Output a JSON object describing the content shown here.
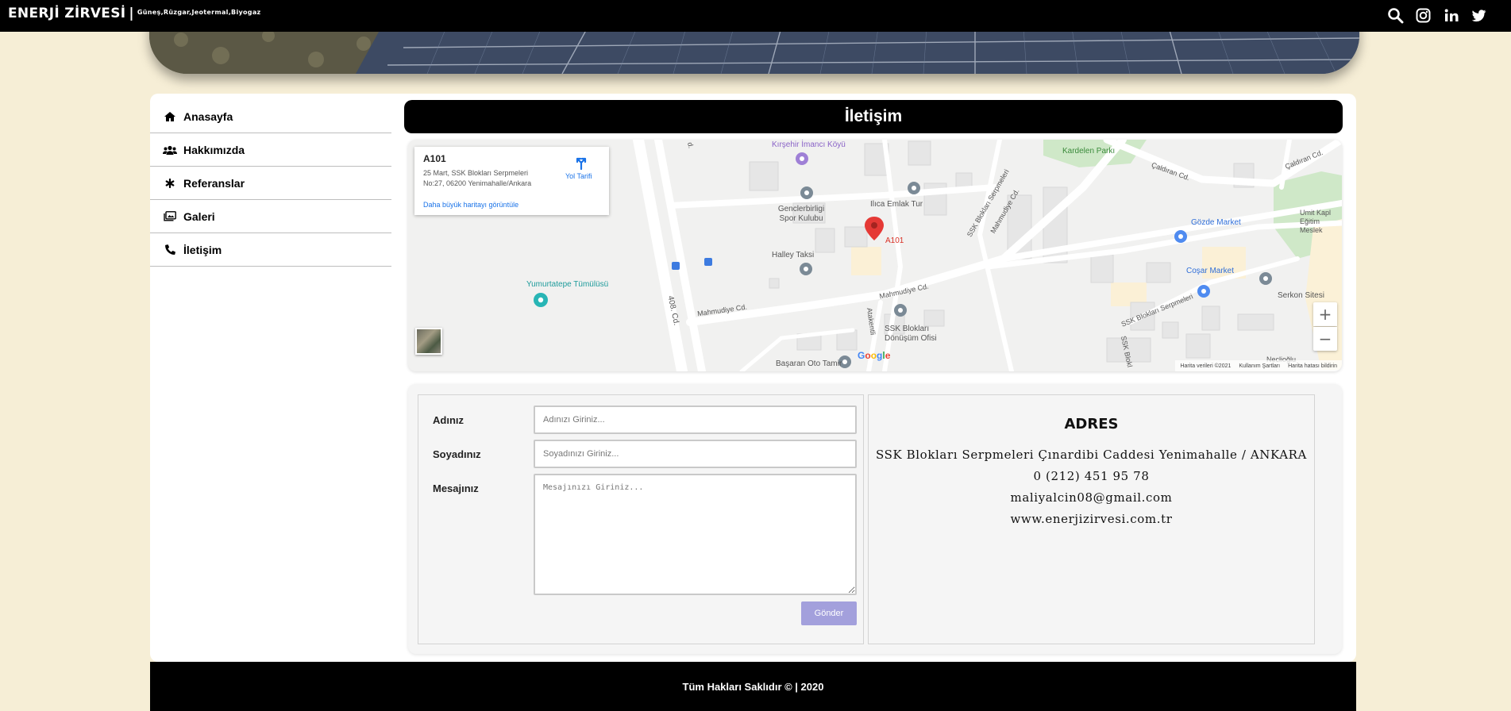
{
  "header": {
    "brand": "ENERJİ ZİRVESİ",
    "separator": "|",
    "tagline": "Güneş,Rüzgar,Jeotermal,Biyogaz",
    "icons": [
      "search-icon",
      "instagram-icon",
      "linkedin-icon",
      "twitter-icon"
    ]
  },
  "sidebar": {
    "items": [
      {
        "label": "Anasayfa",
        "icon": "home-icon"
      },
      {
        "label": "Hakkımızda",
        "icon": "users-icon"
      },
      {
        "label": "Referanslar",
        "icon": "asterisk-icon"
      },
      {
        "label": "Galeri",
        "icon": "images-icon"
      },
      {
        "label": "İletişim",
        "icon": "phone-icon"
      }
    ]
  },
  "page": {
    "title": "İletişim"
  },
  "map": {
    "place_name": "A101",
    "place_address": "25 Mart, SSK Blokları Serpmeleri No:27, 06200 Yenimahalle/Ankara",
    "directions_label": "Yol Tarifi",
    "bigger_map_link": "Daha büyük haritayı görüntüle",
    "zoom_in": "+",
    "zoom_out": "−",
    "google_logo": "Google",
    "footer": {
      "map_data": "Harita verileri ©2021",
      "terms": "Kullanım Şartları",
      "report": "Harita hatası bildirin"
    },
    "labels": {
      "kirsehir": "Kırşehir İmancı Köyü",
      "kardelen": "Kardelen Parkı",
      "genclerbirligi": "Genclerbirligi Spor Kulubu",
      "ilica": "Ilıca Emlak Tur",
      "a101": "A101",
      "halley": "Halley Taksi",
      "yumurtatepe": "Yumurtatepe Tümülüsü",
      "gozde": "Gözde Market",
      "cosar": "Coşar Market",
      "serkon": "Serkon Sitesi",
      "umit": "Umit Kapl Eğitim Meslek",
      "ssk_donusum": "SSK Blokları Dönüşüm Ofisi",
      "basaran": "Başaran Oto Tamir",
      "mahmudiye1": "Mahmudiye Cd.",
      "mahmudiye2": "Mahmudiye Cd.",
      "mahmudiye3": "Mahmudiye Cd.",
      "cd408": "408. Cd.",
      "caldiran1": "Çaldıran Cd.",
      "caldiran2": "Çaldıran Cd.",
      "ssk_serpmeleri1": "SSK Blokları Serpmeleri",
      "ssk_serpmeleri2": "SSK Blokları Serpmeleri",
      "atakentli": "Atakentli",
      "ssk_blok": "SSK Blokl",
      "neclioglu": "Neclioğlu",
      "cd_edge": "d."
    }
  },
  "form": {
    "name_label": "Adınız",
    "name_placeholder": "Adınızı Giriniz...",
    "surname_label": "Soyadınız",
    "surname_placeholder": "Soyadınızı Giriniz...",
    "message_label": "Mesajınız",
    "message_placeholder": "Mesajınızı Giriniz...",
    "submit_label": "Gönder"
  },
  "address": {
    "title": "ADRES",
    "street": "SSK Blokları Serpmeleri Çınardibi Caddesi Yenimahalle / ANKARA",
    "phone": "0 (212) 451 95 78",
    "email": "maliyalcin08@gmail.com",
    "website": "www.enerjizirvesi.com.tr"
  },
  "footer": {
    "copyright": "Tüm Hakları Saklıdır © | 2020"
  },
  "colors": {
    "background": "#f6eed6",
    "black": "#000000",
    "submit_button": "#a3a0dc",
    "map_link": "#1a73e8",
    "map_pin": "#e53935"
  }
}
